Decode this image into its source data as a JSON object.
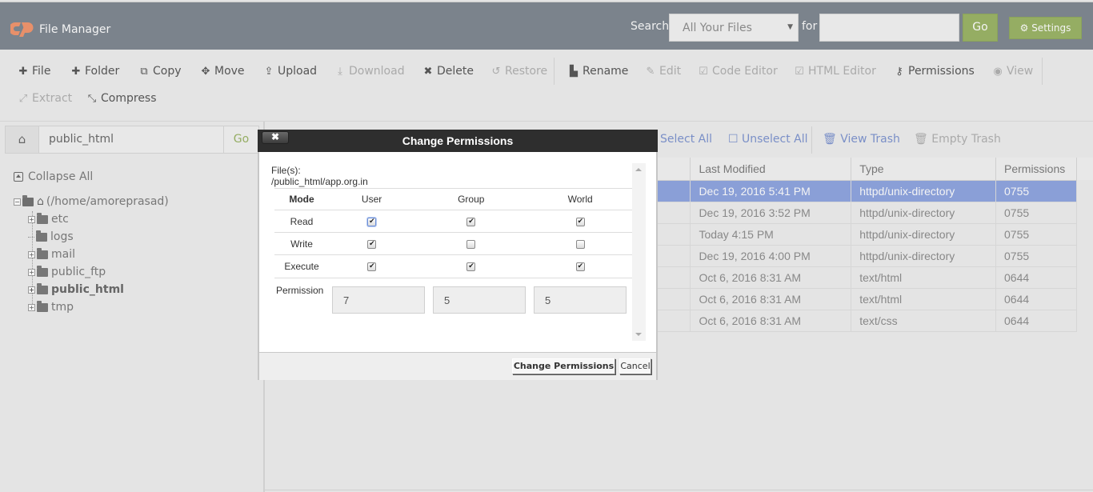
{
  "header": {
    "app_title": "File Manager",
    "search_label": "Search",
    "search_scope": "All Your Files",
    "for_label": "for",
    "search_value": "",
    "go_label": "Go",
    "settings_label": "Settings",
    "colors": {
      "header_bg": "#7b838c",
      "accent_green": "#95ad63",
      "logo_orange": "#e8906a"
    }
  },
  "toolbar": {
    "items": [
      {
        "label": "File",
        "icon": "plus-icon",
        "enabled": true
      },
      {
        "label": "Folder",
        "icon": "plus-icon",
        "enabled": true
      },
      {
        "label": "Copy",
        "icon": "copy-icon",
        "enabled": true
      },
      {
        "label": "Move",
        "icon": "move-icon",
        "enabled": true
      },
      {
        "label": "Upload",
        "icon": "upload-icon",
        "enabled": true
      },
      {
        "label": "Download",
        "icon": "download-icon",
        "enabled": false
      },
      {
        "label": "Delete",
        "icon": "x-icon",
        "enabled": true
      },
      {
        "label": "Restore",
        "icon": "restore-icon",
        "enabled": false
      },
      {
        "label": "Rename",
        "icon": "file-icon",
        "enabled": true
      },
      {
        "label": "Edit",
        "icon": "pencil-icon",
        "enabled": false
      },
      {
        "label": "Code Editor",
        "icon": "edit-icon",
        "enabled": false
      },
      {
        "label": "HTML Editor",
        "icon": "edit-icon",
        "enabled": false
      },
      {
        "label": "Permissions",
        "icon": "key-icon",
        "enabled": true
      },
      {
        "label": "View",
        "icon": "eye-icon",
        "enabled": false
      },
      {
        "label": "Extract",
        "icon": "expand-icon",
        "enabled": false
      },
      {
        "label": "Compress",
        "icon": "compress-icon",
        "enabled": true
      }
    ]
  },
  "left": {
    "path_value": "public_html",
    "go_label": "Go",
    "collapse_all": "Collapse All",
    "tree": {
      "root": "(/home/amoreprasad)",
      "children": [
        {
          "name": "etc",
          "expandable": true,
          "bold": false
        },
        {
          "name": "logs",
          "expandable": false,
          "bold": false
        },
        {
          "name": "mail",
          "expandable": true,
          "bold": false
        },
        {
          "name": "public_ftp",
          "expandable": true,
          "bold": false
        },
        {
          "name": "public_html",
          "expandable": true,
          "bold": true
        },
        {
          "name": "tmp",
          "expandable": true,
          "bold": false
        }
      ]
    }
  },
  "actions": {
    "select_all": "Select All",
    "unselect_all": "Unselect All",
    "view_trash": "View Trash",
    "empty_trash": "Empty Trash"
  },
  "table": {
    "columns": [
      "",
      "Last Modified",
      "Type",
      "Permissions"
    ],
    "rows": [
      {
        "modified": "Dec 19, 2016 5:41 PM",
        "type": "httpd/unix-directory",
        "perms": "0755",
        "selected": true
      },
      {
        "modified": "Dec 19, 2016 3:52 PM",
        "type": "httpd/unix-directory",
        "perms": "0755",
        "selected": false
      },
      {
        "modified": "Today 4:15 PM",
        "type": "httpd/unix-directory",
        "perms": "0755",
        "selected": false
      },
      {
        "modified": "Dec 19, 2016 4:00 PM",
        "type": "httpd/unix-directory",
        "perms": "0755",
        "selected": false
      },
      {
        "modified": "Oct 6, 2016 8:31 AM",
        "type": "text/html",
        "perms": "0644",
        "selected": false
      },
      {
        "modified": "Oct 6, 2016 8:31 AM",
        "type": "text/html",
        "perms": "0644",
        "selected": false
      },
      {
        "modified": "Oct 6, 2016 8:31 AM",
        "type": "text/css",
        "perms": "0644",
        "selected": false
      }
    ],
    "selected_color": "#8a9fd7"
  },
  "dialog": {
    "title": "Change Permissions",
    "close_label": "✖",
    "files_label": "File(s):",
    "files_path": "/public_html/app.org.in",
    "headers": {
      "mode": "Mode",
      "user": "User",
      "group": "Group",
      "world": "World"
    },
    "rows": [
      {
        "label": "Read",
        "user": true,
        "group": true,
        "world": true
      },
      {
        "label": "Write",
        "user": true,
        "group": false,
        "world": false
      },
      {
        "label": "Execute",
        "user": true,
        "group": true,
        "world": true
      }
    ],
    "permission_label": "Permission",
    "permission_values": {
      "user": "7",
      "group": "5",
      "world": "5"
    },
    "change_button": "Change Permissions",
    "cancel_button": "Cancel"
  }
}
